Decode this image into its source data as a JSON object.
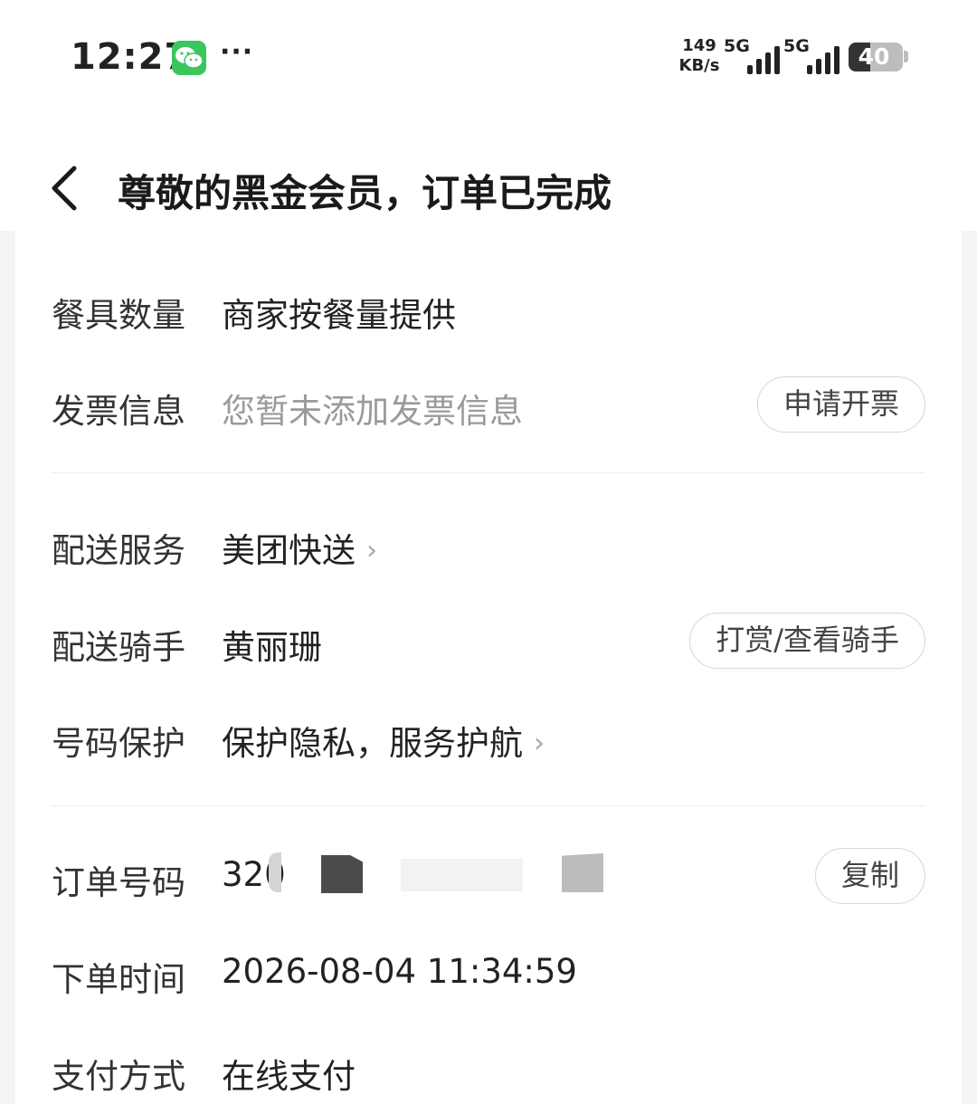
{
  "status_bar": {
    "time": "12:27",
    "more": "···",
    "net_speed": [
      "149",
      "KB/s"
    ],
    "signal_1": "5G",
    "signal_2": "5G",
    "battery": "40"
  },
  "header": {
    "title": "尊敬的黑金会员，订单已完成"
  },
  "details": {
    "tableware": {
      "label": "餐具数量",
      "value": "商家按餐量提供"
    },
    "invoice": {
      "label": "发票信息",
      "value": "您暂未添加发票信息",
      "button": "申请开票"
    },
    "delivery_service": {
      "label": "配送服务",
      "value": "美团快送"
    },
    "rider": {
      "label": "配送骑手",
      "value": "黄丽珊",
      "button": "打赏/查看骑手"
    },
    "number_protection": {
      "label": "号码保护",
      "value": "保护隐私，服务护航"
    },
    "order_no": {
      "label": "订单号码",
      "value_visible": "320",
      "button": "复制"
    },
    "order_time": {
      "label": "下单时间",
      "value": "2026-08-04 11:34:59"
    },
    "payment": {
      "label": "支付方式",
      "value": "在线支付"
    }
  },
  "colors": {
    "wechat_green": "#3cc55d",
    "muted_text": "#9a9a9a",
    "page_bg": "#f4f4f4"
  }
}
